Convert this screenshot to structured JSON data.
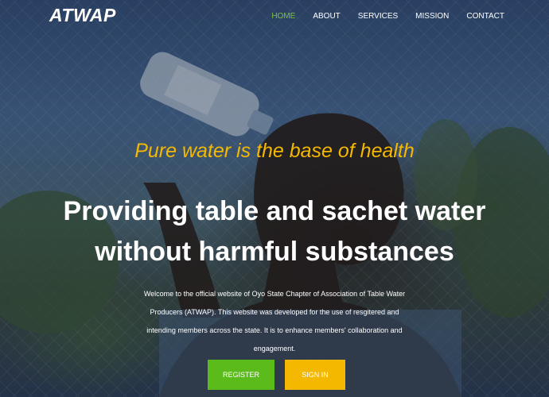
{
  "brand": "ATWAP",
  "nav": {
    "items": [
      {
        "label": "HOME",
        "active": true
      },
      {
        "label": "ABOUT",
        "active": false
      },
      {
        "label": "SERVICES",
        "active": false
      },
      {
        "label": "MISSION",
        "active": false
      },
      {
        "label": "CONTACT",
        "active": false
      }
    ]
  },
  "hero": {
    "tagline": "Pure water is the base of health",
    "headline": "Providing table and sachet water without harmful substances",
    "description": "Welcome to the official website of Oyo State Chapter of Association of Table Water Producers (ATWAP). This website was developed for the use of resgitered and intending members across the state. It is to enhance members' collaboration and engagement.",
    "register_label": "REGISTER",
    "signin_label": "SIGN IN"
  },
  "colors": {
    "accent_green": "#5bbb1b",
    "accent_yellow": "#f5b800",
    "active_nav": "#7cc43a"
  }
}
